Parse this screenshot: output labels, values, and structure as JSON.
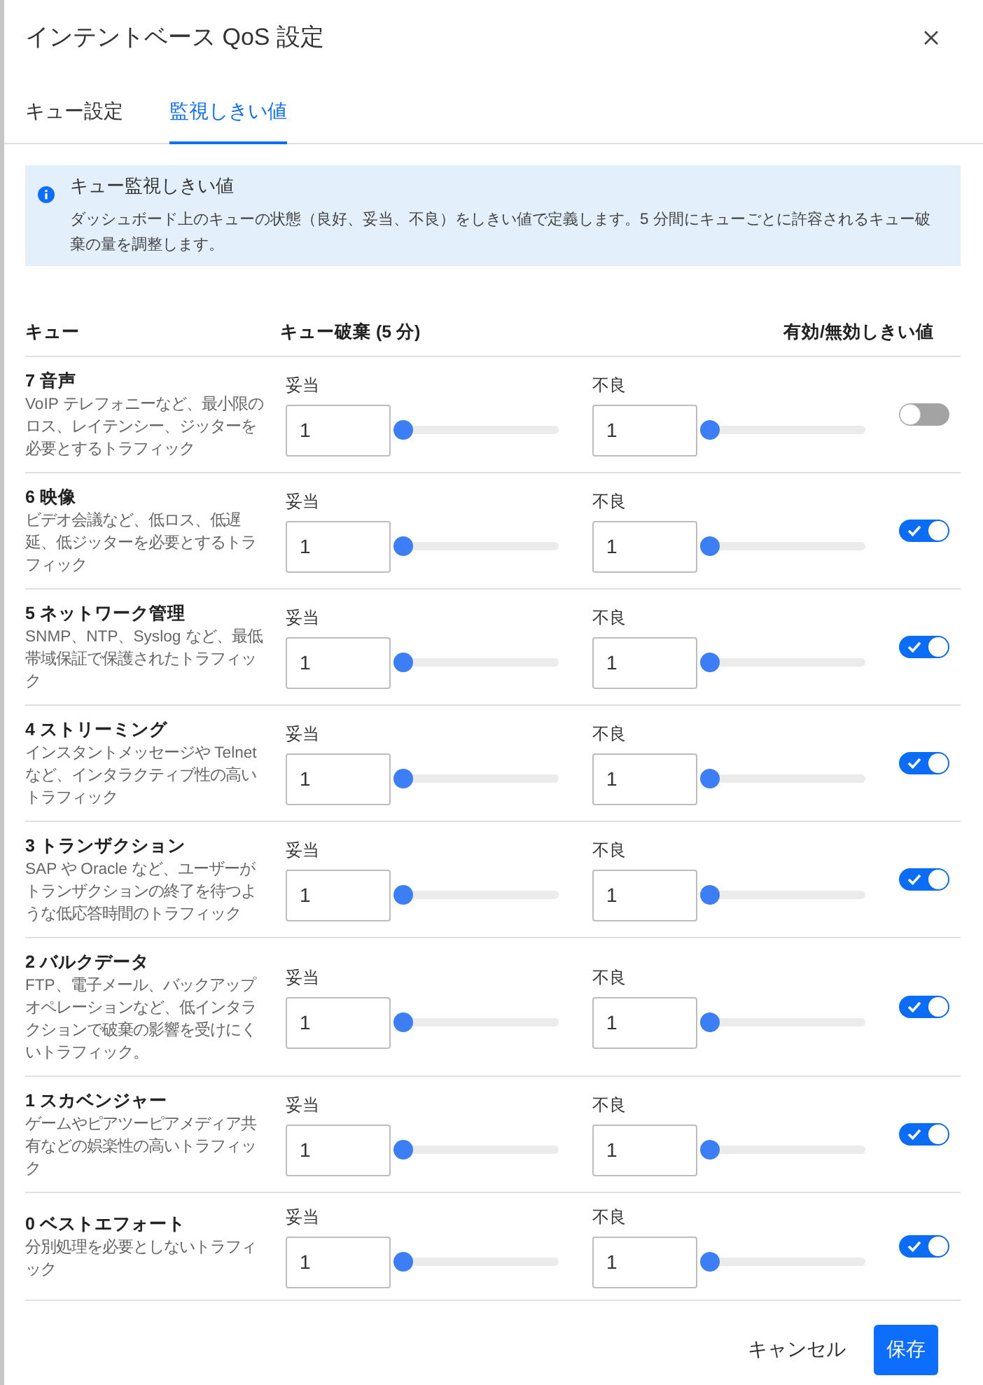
{
  "dialog": {
    "title": "インテントベース QoS 設定"
  },
  "tabs": [
    {
      "label": "キュー設定",
      "selected": false
    },
    {
      "label": "監視しきい値",
      "selected": true
    }
  ],
  "info": {
    "title": "キュー監視しきい値",
    "text": "ダッシュボード上のキューの状態（良好、妥当、不良）をしきい値で定義します。5 分間にキューごとに許容されるキュー破棄の量を調整します。"
  },
  "table": {
    "columns": [
      "キュー",
      "キュー破棄 (5 分)",
      "有効/無効しきい値"
    ],
    "rows": [
      {
        "name": "7 音声",
        "description": "VoIP テレフォニーなど、最小限のロス、レイテンシー、ジッターを必要とするトラフィック",
        "thresholds": [
          {
            "label": "妥当",
            "value": "1",
            "level": 0
          },
          {
            "label": "不良",
            "value": "1",
            "level": 0
          }
        ],
        "enabled": false
      },
      {
        "name": "6 映像",
        "description": "ビデオ会議など、低ロス、低遅延、低ジッターを必要とするトラフィック",
        "thresholds": [
          {
            "label": "妥当",
            "value": "1",
            "level": 0
          },
          {
            "label": "不良",
            "value": "1",
            "level": 0
          }
        ],
        "enabled": true
      },
      {
        "name": "5 ネットワーク管理",
        "description": "SNMP、NTP、Syslog など、最低帯域保証で保護されたトラフィック",
        "thresholds": [
          {
            "label": "妥当",
            "value": "1",
            "level": 0
          },
          {
            "label": "不良",
            "value": "1",
            "level": 0
          }
        ],
        "enabled": true
      },
      {
        "name": "4 ストリーミング",
        "description": "インスタントメッセージや Telnet など、インタラクティブ性の高いトラフィック",
        "thresholds": [
          {
            "label": "妥当",
            "value": "1",
            "level": 0
          },
          {
            "label": "不良",
            "value": "1",
            "level": 0
          }
        ],
        "enabled": true
      },
      {
        "name": "3 トランザクション",
        "description": "SAP や Oracle など、ユーザーがトランザクションの終了を待つような低応答時間のトラフィック",
        "thresholds": [
          {
            "label": "妥当",
            "value": "1",
            "level": 0
          },
          {
            "label": "不良",
            "value": "1",
            "level": 0
          }
        ],
        "enabled": true
      },
      {
        "name": "2 バルクデータ",
        "description": "FTP、電子メール、バックアップオペレーションなど、低インタラクションで破棄の影響を受けにくいトラフィック。",
        "thresholds": [
          {
            "label": "妥当",
            "value": "1",
            "level": 0
          },
          {
            "label": "不良",
            "value": "1",
            "level": 0
          }
        ],
        "enabled": true
      },
      {
        "name": "1 スカベンジャー",
        "description": "ゲームやピアツーピアメディア共有などの娯楽性の高いトラフィック",
        "thresholds": [
          {
            "label": "妥当",
            "value": "1",
            "level": 0
          },
          {
            "label": "不良",
            "value": "1",
            "level": 0
          }
        ],
        "enabled": true
      },
      {
        "name": "0 ベストエフォート",
        "description": "分別処理を必要としないトラフィック",
        "thresholds": [
          {
            "label": "妥当",
            "value": "1",
            "level": 0
          },
          {
            "label": "不良",
            "value": "1",
            "level": 0
          }
        ],
        "enabled": true
      }
    ]
  },
  "buttons": [
    {
      "label": "キャンセル",
      "kind": "secondary"
    },
    {
      "label": "保存",
      "kind": "primary"
    }
  ]
}
